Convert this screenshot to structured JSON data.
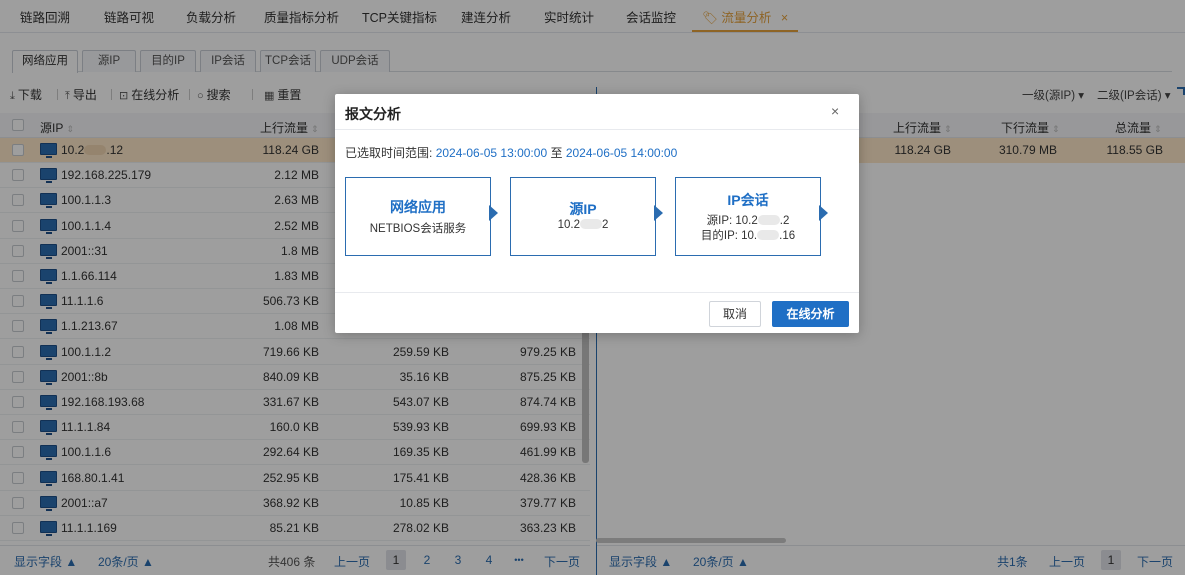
{
  "top_tabs": [
    "链路回溯",
    "链路可视",
    "负载分析",
    "质量指标分析",
    "TCP关键指标",
    "建连分析",
    "实时统计",
    "会话监控",
    "流量分析"
  ],
  "active_tab_close": "×",
  "sub_tabs": [
    "网络应用",
    "源IP",
    "目的IP",
    "IP会话",
    "TCP会话",
    "UDP会话"
  ],
  "toolbar": {
    "download": "下载",
    "export": "导出",
    "online_analysis": "在线分析",
    "search": "搜索",
    "reset": "重置"
  },
  "level_dropdowns": {
    "level1": "一级(源IP)",
    "level2": "二级(IP会话)"
  },
  "left_table": {
    "headers": {
      "src_ip": "源IP",
      "up_flow": "上行流量"
    },
    "rows": [
      {
        "ip_prefix": "10.2",
        "ip_suffix": ".12",
        "up": "118.24 GB",
        "down": "",
        "total": ""
      },
      {
        "ip": "192.168.225.179",
        "up": "2.12 MB",
        "down": "",
        "total": ""
      },
      {
        "ip": "100.1.1.3",
        "up": "2.63 MB",
        "down": "",
        "total": ""
      },
      {
        "ip": "100.1.1.4",
        "up": "2.52 MB",
        "down": "",
        "total": ""
      },
      {
        "ip": "2001::31",
        "up": "1.8 MB",
        "down": "",
        "total": ""
      },
      {
        "ip": "1.1.66.114",
        "up": "1.83 MB",
        "down": "",
        "total": ""
      },
      {
        "ip": "11.1.1.6",
        "up": "506.73 KB",
        "down": "",
        "total": ""
      },
      {
        "ip": "1.1.213.67",
        "up": "1.08 MB",
        "down": "",
        "total": ""
      },
      {
        "ip": "100.1.1.2",
        "up": "719.66 KB",
        "down": "259.59 KB",
        "total": "979.25 KB"
      },
      {
        "ip": "2001::8b",
        "up": "840.09 KB",
        "down": "35.16 KB",
        "total": "875.25 KB"
      },
      {
        "ip": "192.168.193.68",
        "up": "331.67 KB",
        "down": "543.07 KB",
        "total": "874.74 KB"
      },
      {
        "ip": "11.1.1.84",
        "up": "160.0 KB",
        "down": "539.93 KB",
        "total": "699.93 KB"
      },
      {
        "ip": "100.1.1.6",
        "up": "292.64 KB",
        "down": "169.35 KB",
        "total": "461.99 KB"
      },
      {
        "ip": "168.80.1.41",
        "up": "252.95 KB",
        "down": "175.41 KB",
        "total": "428.36 KB"
      },
      {
        "ip": "2001::a7",
        "up": "368.92 KB",
        "down": "10.85 KB",
        "total": "379.77 KB"
      },
      {
        "ip": "11.1.1.169",
        "up": "85.21 KB",
        "down": "278.02 KB",
        "total": "363.23 KB"
      }
    ]
  },
  "right_table": {
    "headers": {
      "up_flow": "上行流量",
      "down_flow": "下行流量",
      "total_flow": "总流量"
    },
    "row": {
      "up": "118.24 GB",
      "down": "310.79 MB",
      "total": "118.55 GB"
    }
  },
  "left_footer": {
    "fields": "显示字段",
    "per_page": "20条/页",
    "total": "共406 条",
    "prev": "上一页",
    "pages": [
      "1",
      "2",
      "3",
      "4"
    ],
    "more": "•••",
    "next": "下一页"
  },
  "right_footer": {
    "fields": "显示字段",
    "per_page": "20条/页",
    "total": "共1条",
    "prev": "上一页",
    "page": "1",
    "next": "下一页"
  },
  "dialog": {
    "title": "报文分析",
    "close": "×",
    "range_label": "已选取时间范围:",
    "range_start": "2024-06-05 13:00:00",
    "range_to": "至",
    "range_end": "2024-06-05 14:00:00",
    "box1": {
      "title": "网络应用",
      "value": "NETBIOS会话服务"
    },
    "box2": {
      "title": "源IP",
      "value_prefix": "10.2",
      "value_suffix": "2"
    },
    "box3": {
      "title": "IP会话",
      "src_label": "源IP: 10.2",
      "src_suffix": ".2",
      "dst_label": "目的IP: 10.",
      "dst_suffix": ".16"
    },
    "cancel": "取消",
    "confirm": "在线分析"
  }
}
